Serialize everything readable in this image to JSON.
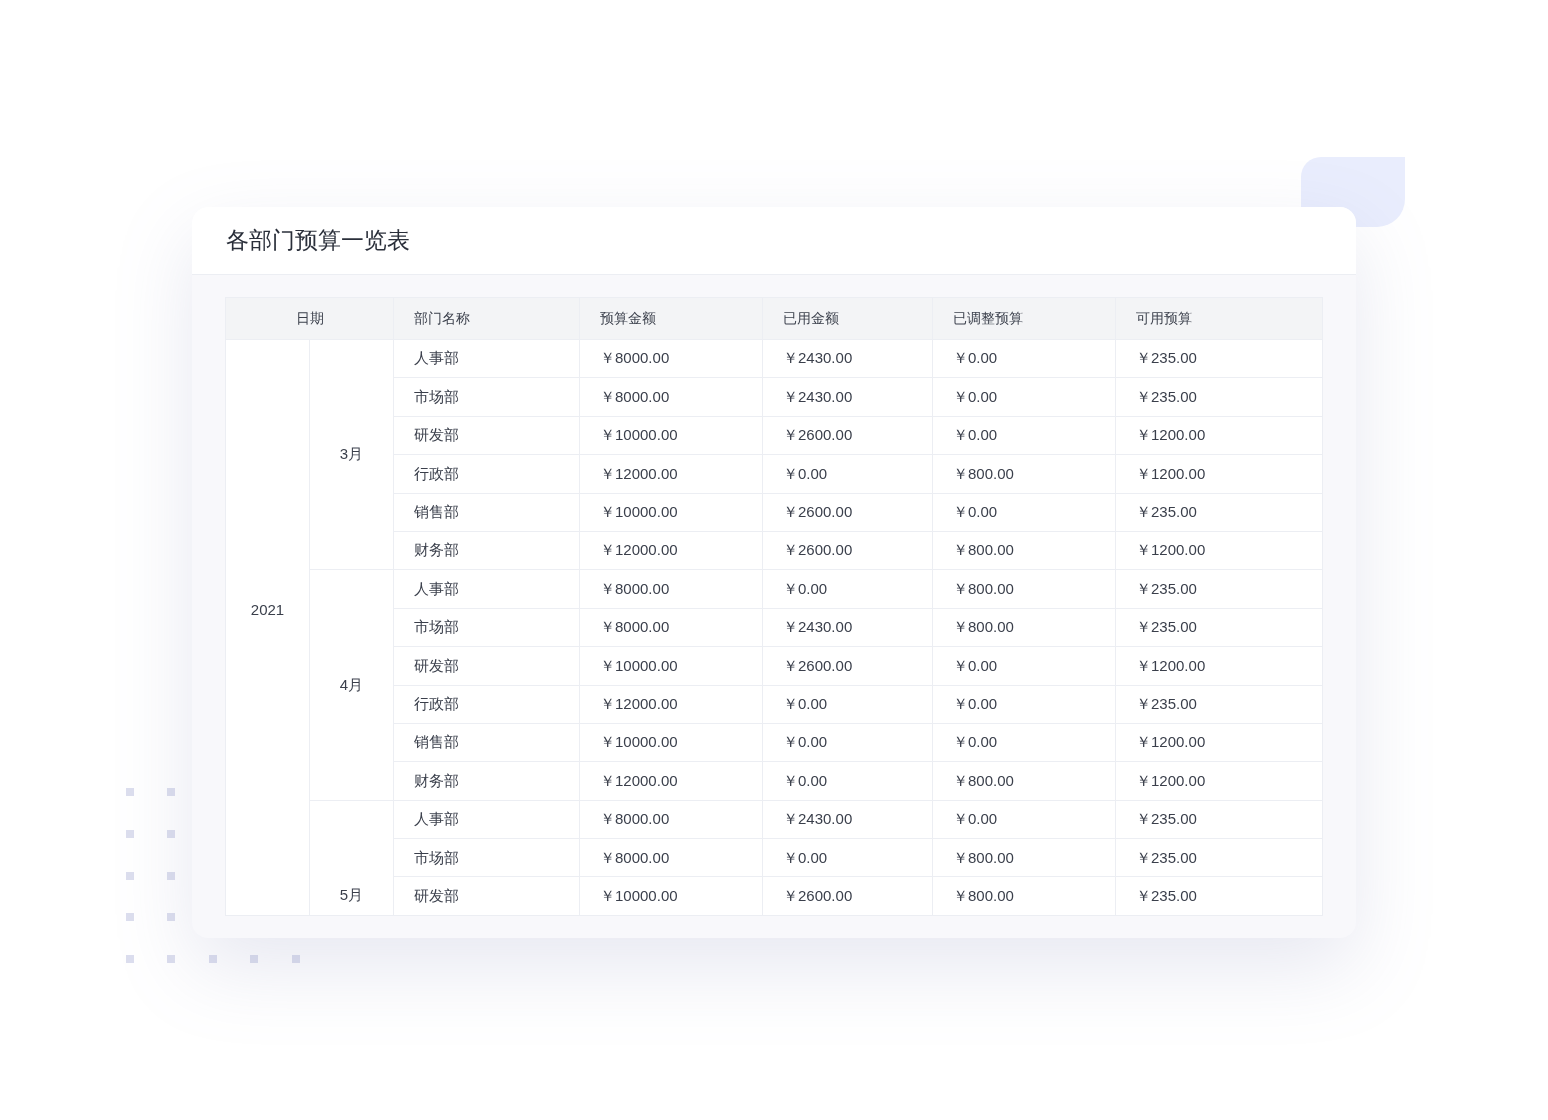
{
  "title": "各部门预算一览表",
  "table": {
    "columns": [
      "日期",
      "部门名称",
      "预算金额",
      "已用金额",
      "已调整预算",
      "可用预算"
    ],
    "years": [
      {
        "label": "2021",
        "months": [
          {
            "label": "3月",
            "rows": [
              {
                "department": "人事部",
                "budget": "￥8000.00",
                "used": "￥2430.00",
                "adjusted": "￥0.00",
                "available": "￥235.00"
              },
              {
                "department": "市场部",
                "budget": "￥8000.00",
                "used": "￥2430.00",
                "adjusted": "￥0.00",
                "available": "￥235.00"
              },
              {
                "department": "研发部",
                "budget": "￥10000.00",
                "used": "￥2600.00",
                "adjusted": "￥0.00",
                "available": "￥1200.00"
              },
              {
                "department": "行政部",
                "budget": "￥12000.00",
                "used": "￥0.00",
                "adjusted": "￥800.00",
                "available": "￥1200.00"
              },
              {
                "department": "销售部",
                "budget": "￥10000.00",
                "used": "￥2600.00",
                "adjusted": "￥0.00",
                "available": "￥235.00"
              },
              {
                "department": "财务部",
                "budget": "￥12000.00",
                "used": "￥2600.00",
                "adjusted": "￥800.00",
                "available": "￥1200.00"
              }
            ]
          },
          {
            "label": "4月",
            "rows": [
              {
                "department": "人事部",
                "budget": "￥8000.00",
                "used": "￥0.00",
                "adjusted": "￥800.00",
                "available": "￥235.00"
              },
              {
                "department": "市场部",
                "budget": "￥8000.00",
                "used": "￥2430.00",
                "adjusted": "￥800.00",
                "available": "￥235.00"
              },
              {
                "department": "研发部",
                "budget": "￥10000.00",
                "used": "￥2600.00",
                "adjusted": "￥0.00",
                "available": "￥1200.00"
              },
              {
                "department": "行政部",
                "budget": "￥12000.00",
                "used": "￥0.00",
                "adjusted": "￥0.00",
                "available": "￥235.00"
              },
              {
                "department": "销售部",
                "budget": "￥10000.00",
                "used": "￥0.00",
                "adjusted": "￥0.00",
                "available": "￥1200.00"
              },
              {
                "department": "财务部",
                "budget": "￥12000.00",
                "used": "￥0.00",
                "adjusted": "￥800.00",
                "available": "￥1200.00"
              }
            ]
          },
          {
            "label": "5月",
            "rows": [
              {
                "department": "人事部",
                "budget": "￥8000.00",
                "used": "￥2430.00",
                "adjusted": "￥0.00",
                "available": "￥235.00"
              },
              {
                "department": "市场部",
                "budget": "￥8000.00",
                "used": "￥0.00",
                "adjusted": "￥800.00",
                "available": "￥235.00"
              },
              {
                "department": "研发部",
                "budget": "￥10000.00",
                "used": "￥2600.00",
                "adjusted": "￥800.00",
                "available": "￥235.00"
              }
            ]
          }
        ]
      }
    ]
  }
}
